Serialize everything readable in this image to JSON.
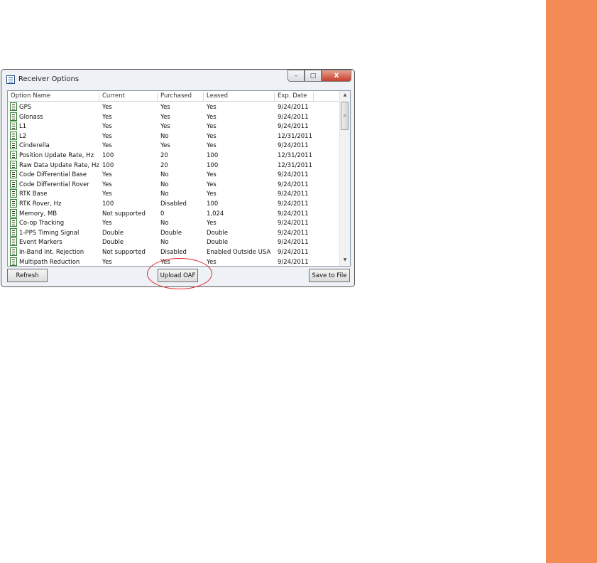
{
  "colors": {
    "sidebar": "#f48a56",
    "highlight": "#e0232a"
  },
  "window": {
    "title": "Receiver Options",
    "icon": "list-window-icon",
    "controls": {
      "minimize": "–",
      "maximize": "□",
      "close": "X"
    }
  },
  "table": {
    "columns": [
      "Option Name",
      "Current",
      "Purchased",
      "Leased",
      "Exp. Date"
    ],
    "rows": [
      [
        "GPS",
        "Yes",
        "Yes",
        "Yes",
        "9/24/2011"
      ],
      [
        "Glonass",
        "Yes",
        "Yes",
        "Yes",
        "9/24/2011"
      ],
      [
        "L1",
        "Yes",
        "Yes",
        "Yes",
        "9/24/2011"
      ],
      [
        "L2",
        "Yes",
        "No",
        "Yes",
        "12/31/2011"
      ],
      [
        "Cinderella",
        "Yes",
        "Yes",
        "Yes",
        "9/24/2011"
      ],
      [
        "Position Update Rate, Hz",
        "100",
        "20",
        "100",
        "12/31/2011"
      ],
      [
        "Raw Data Update Rate, Hz",
        "100",
        "20",
        "100",
        "12/31/2011"
      ],
      [
        "Code Differential Base",
        "Yes",
        "No",
        "Yes",
        "9/24/2011"
      ],
      [
        "Code Differential Rover",
        "Yes",
        "No",
        "Yes",
        "9/24/2011"
      ],
      [
        "RTK Base",
        "Yes",
        "No",
        "Yes",
        "9/24/2011"
      ],
      [
        "RTK Rover, Hz",
        "100",
        "Disabled",
        "100",
        "9/24/2011"
      ],
      [
        "Memory, MB",
        "Not supported",
        "0",
        "1,024",
        "9/24/2011"
      ],
      [
        "Co-op Tracking",
        "Yes",
        "No",
        "Yes",
        "9/24/2011"
      ],
      [
        "1-PPS Timing Signal",
        "Double",
        "Double",
        "Double",
        "9/24/2011"
      ],
      [
        "Event Markers",
        "Double",
        "No",
        "Double",
        "9/24/2011"
      ],
      [
        "In-Band Int. Rejection",
        "Not supported",
        "Disabled",
        "Enabled Outside USA",
        "9/24/2011"
      ],
      [
        "Multipath Reduction",
        "Yes",
        "Yes",
        "Yes",
        "9/24/2011"
      ]
    ]
  },
  "buttons": {
    "refresh": "Refresh",
    "upload": "Upload OAF",
    "save": "Save to File"
  }
}
